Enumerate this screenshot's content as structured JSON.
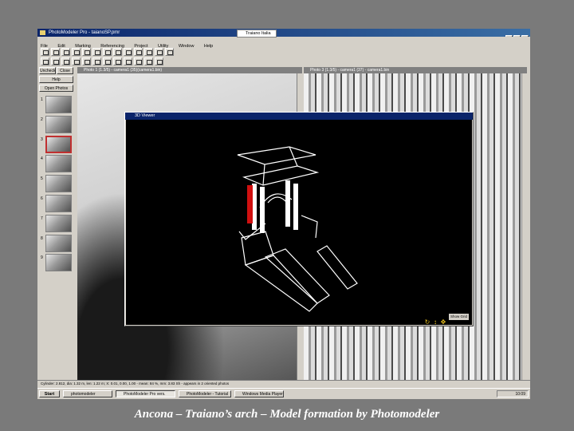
{
  "app": {
    "title": "PhotoModeler Pro - taianoSP.pmr",
    "secondary_window": "Traiano Italia"
  },
  "menu": [
    "File",
    "Edit",
    "Marking",
    "Referencing",
    "Project",
    "Utility",
    "Window",
    "Help"
  ],
  "left_panel": {
    "buttons": [
      "Uncheck",
      "Close",
      "Help",
      "Open Photos"
    ],
    "photo_numbers": [
      "1",
      "2",
      "3",
      "4",
      "5",
      "6",
      "7",
      "8",
      "9"
    ],
    "selected_index": 2
  },
  "photos": {
    "left_title": "Photo 1 (1.3/5) - camera1 (35)(camera1.bin)",
    "right_title": "Photo 3 (1.3/5) - camera1 (37) - camera1.bin"
  },
  "viewer": {
    "title": "3D Viewer",
    "tool_label": "Show Grid",
    "tool_icons": [
      "rotate-icon",
      "zoom-icon",
      "pan-icon"
    ]
  },
  "statusbar": "Cylinder: 2.812, dia: 1.32 m, len: 1.22 m; X: 0.01, 0.00, 1.00 - mean: 84 %, mm: 3.83 Sh - appears in 2 oriented photos",
  "taskbar": {
    "start": "Start",
    "tasks": [
      "photomodeler",
      "PhotoModeler Pro vers.",
      "PhotoModeler - Tutorial",
      "Windows Media Player"
    ],
    "clock": "10:09"
  },
  "caption": "Ancona – Traiano’s arch – Model formation by Photomodeler",
  "colors": {
    "highlight": "#d01010",
    "wire": "#ffffff",
    "viewer_bg": "#000000"
  }
}
